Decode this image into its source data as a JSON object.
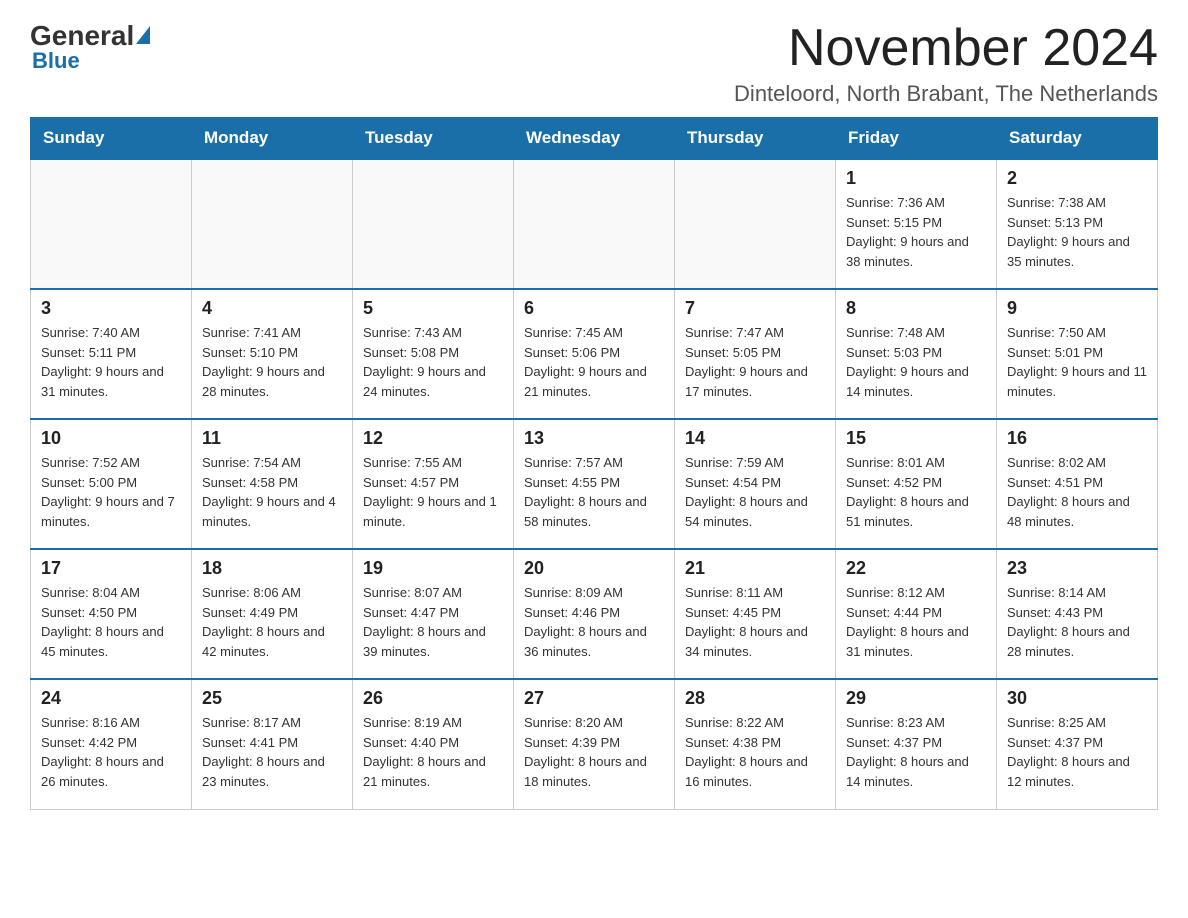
{
  "header": {
    "logo_general": "General",
    "logo_blue": "Blue",
    "main_title": "November 2024",
    "subtitle": "Dinteloord, North Brabant, The Netherlands"
  },
  "days_of_week": [
    "Sunday",
    "Monday",
    "Tuesday",
    "Wednesday",
    "Thursday",
    "Friday",
    "Saturday"
  ],
  "weeks": [
    [
      {
        "day": "",
        "sunrise": "",
        "sunset": "",
        "daylight": ""
      },
      {
        "day": "",
        "sunrise": "",
        "sunset": "",
        "daylight": ""
      },
      {
        "day": "",
        "sunrise": "",
        "sunset": "",
        "daylight": ""
      },
      {
        "day": "",
        "sunrise": "",
        "sunset": "",
        "daylight": ""
      },
      {
        "day": "",
        "sunrise": "",
        "sunset": "",
        "daylight": ""
      },
      {
        "day": "1",
        "sunrise": "Sunrise: 7:36 AM",
        "sunset": "Sunset: 5:15 PM",
        "daylight": "Daylight: 9 hours and 38 minutes."
      },
      {
        "day": "2",
        "sunrise": "Sunrise: 7:38 AM",
        "sunset": "Sunset: 5:13 PM",
        "daylight": "Daylight: 9 hours and 35 minutes."
      }
    ],
    [
      {
        "day": "3",
        "sunrise": "Sunrise: 7:40 AM",
        "sunset": "Sunset: 5:11 PM",
        "daylight": "Daylight: 9 hours and 31 minutes."
      },
      {
        "day": "4",
        "sunrise": "Sunrise: 7:41 AM",
        "sunset": "Sunset: 5:10 PM",
        "daylight": "Daylight: 9 hours and 28 minutes."
      },
      {
        "day": "5",
        "sunrise": "Sunrise: 7:43 AM",
        "sunset": "Sunset: 5:08 PM",
        "daylight": "Daylight: 9 hours and 24 minutes."
      },
      {
        "day": "6",
        "sunrise": "Sunrise: 7:45 AM",
        "sunset": "Sunset: 5:06 PM",
        "daylight": "Daylight: 9 hours and 21 minutes."
      },
      {
        "day": "7",
        "sunrise": "Sunrise: 7:47 AM",
        "sunset": "Sunset: 5:05 PM",
        "daylight": "Daylight: 9 hours and 17 minutes."
      },
      {
        "day": "8",
        "sunrise": "Sunrise: 7:48 AM",
        "sunset": "Sunset: 5:03 PM",
        "daylight": "Daylight: 9 hours and 14 minutes."
      },
      {
        "day": "9",
        "sunrise": "Sunrise: 7:50 AM",
        "sunset": "Sunset: 5:01 PM",
        "daylight": "Daylight: 9 hours and 11 minutes."
      }
    ],
    [
      {
        "day": "10",
        "sunrise": "Sunrise: 7:52 AM",
        "sunset": "Sunset: 5:00 PM",
        "daylight": "Daylight: 9 hours and 7 minutes."
      },
      {
        "day": "11",
        "sunrise": "Sunrise: 7:54 AM",
        "sunset": "Sunset: 4:58 PM",
        "daylight": "Daylight: 9 hours and 4 minutes."
      },
      {
        "day": "12",
        "sunrise": "Sunrise: 7:55 AM",
        "sunset": "Sunset: 4:57 PM",
        "daylight": "Daylight: 9 hours and 1 minute."
      },
      {
        "day": "13",
        "sunrise": "Sunrise: 7:57 AM",
        "sunset": "Sunset: 4:55 PM",
        "daylight": "Daylight: 8 hours and 58 minutes."
      },
      {
        "day": "14",
        "sunrise": "Sunrise: 7:59 AM",
        "sunset": "Sunset: 4:54 PM",
        "daylight": "Daylight: 8 hours and 54 minutes."
      },
      {
        "day": "15",
        "sunrise": "Sunrise: 8:01 AM",
        "sunset": "Sunset: 4:52 PM",
        "daylight": "Daylight: 8 hours and 51 minutes."
      },
      {
        "day": "16",
        "sunrise": "Sunrise: 8:02 AM",
        "sunset": "Sunset: 4:51 PM",
        "daylight": "Daylight: 8 hours and 48 minutes."
      }
    ],
    [
      {
        "day": "17",
        "sunrise": "Sunrise: 8:04 AM",
        "sunset": "Sunset: 4:50 PM",
        "daylight": "Daylight: 8 hours and 45 minutes."
      },
      {
        "day": "18",
        "sunrise": "Sunrise: 8:06 AM",
        "sunset": "Sunset: 4:49 PM",
        "daylight": "Daylight: 8 hours and 42 minutes."
      },
      {
        "day": "19",
        "sunrise": "Sunrise: 8:07 AM",
        "sunset": "Sunset: 4:47 PM",
        "daylight": "Daylight: 8 hours and 39 minutes."
      },
      {
        "day": "20",
        "sunrise": "Sunrise: 8:09 AM",
        "sunset": "Sunset: 4:46 PM",
        "daylight": "Daylight: 8 hours and 36 minutes."
      },
      {
        "day": "21",
        "sunrise": "Sunrise: 8:11 AM",
        "sunset": "Sunset: 4:45 PM",
        "daylight": "Daylight: 8 hours and 34 minutes."
      },
      {
        "day": "22",
        "sunrise": "Sunrise: 8:12 AM",
        "sunset": "Sunset: 4:44 PM",
        "daylight": "Daylight: 8 hours and 31 minutes."
      },
      {
        "day": "23",
        "sunrise": "Sunrise: 8:14 AM",
        "sunset": "Sunset: 4:43 PM",
        "daylight": "Daylight: 8 hours and 28 minutes."
      }
    ],
    [
      {
        "day": "24",
        "sunrise": "Sunrise: 8:16 AM",
        "sunset": "Sunset: 4:42 PM",
        "daylight": "Daylight: 8 hours and 26 minutes."
      },
      {
        "day": "25",
        "sunrise": "Sunrise: 8:17 AM",
        "sunset": "Sunset: 4:41 PM",
        "daylight": "Daylight: 8 hours and 23 minutes."
      },
      {
        "day": "26",
        "sunrise": "Sunrise: 8:19 AM",
        "sunset": "Sunset: 4:40 PM",
        "daylight": "Daylight: 8 hours and 21 minutes."
      },
      {
        "day": "27",
        "sunrise": "Sunrise: 8:20 AM",
        "sunset": "Sunset: 4:39 PM",
        "daylight": "Daylight: 8 hours and 18 minutes."
      },
      {
        "day": "28",
        "sunrise": "Sunrise: 8:22 AM",
        "sunset": "Sunset: 4:38 PM",
        "daylight": "Daylight: 8 hours and 16 minutes."
      },
      {
        "day": "29",
        "sunrise": "Sunrise: 8:23 AM",
        "sunset": "Sunset: 4:37 PM",
        "daylight": "Daylight: 8 hours and 14 minutes."
      },
      {
        "day": "30",
        "sunrise": "Sunrise: 8:25 AM",
        "sunset": "Sunset: 4:37 PM",
        "daylight": "Daylight: 8 hours and 12 minutes."
      }
    ]
  ]
}
